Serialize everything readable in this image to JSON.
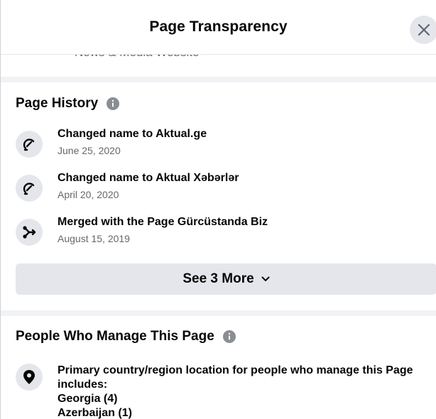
{
  "header": {
    "title": "Page Transparency",
    "close_icon": "close-icon"
  },
  "category": {
    "text": "News & Media Website"
  },
  "history": {
    "title": "Page History",
    "info_icon": "info-icon",
    "items": [
      {
        "title": "Changed name to Aktual.ge",
        "date": "June 25, 2020",
        "icon": "edit-icon"
      },
      {
        "title": "Changed name to Aktual Xəbərlər",
        "date": "April 20, 2020",
        "icon": "edit-icon"
      },
      {
        "title": "Merged with the Page Gürcüstanda Biz",
        "date": "August 15, 2019",
        "icon": "merge-icon"
      }
    ],
    "see_more_label": "See 3 More",
    "see_more_icon": "chevron-down-icon"
  },
  "managers": {
    "title": "People Who Manage This Page",
    "info_icon": "info-icon",
    "location_icon": "location-pin-icon",
    "description": "Primary country/region location for people who manage this Page includes:",
    "countries": [
      {
        "label": "Georgia (4)"
      },
      {
        "label": "Azerbaijan (1)"
      }
    ]
  },
  "colors": {
    "primary_text": "#050505",
    "secondary_text": "#65676b",
    "button_bg": "#e4e6eb",
    "divider": "#f0f2f5",
    "icon": "#050505"
  }
}
